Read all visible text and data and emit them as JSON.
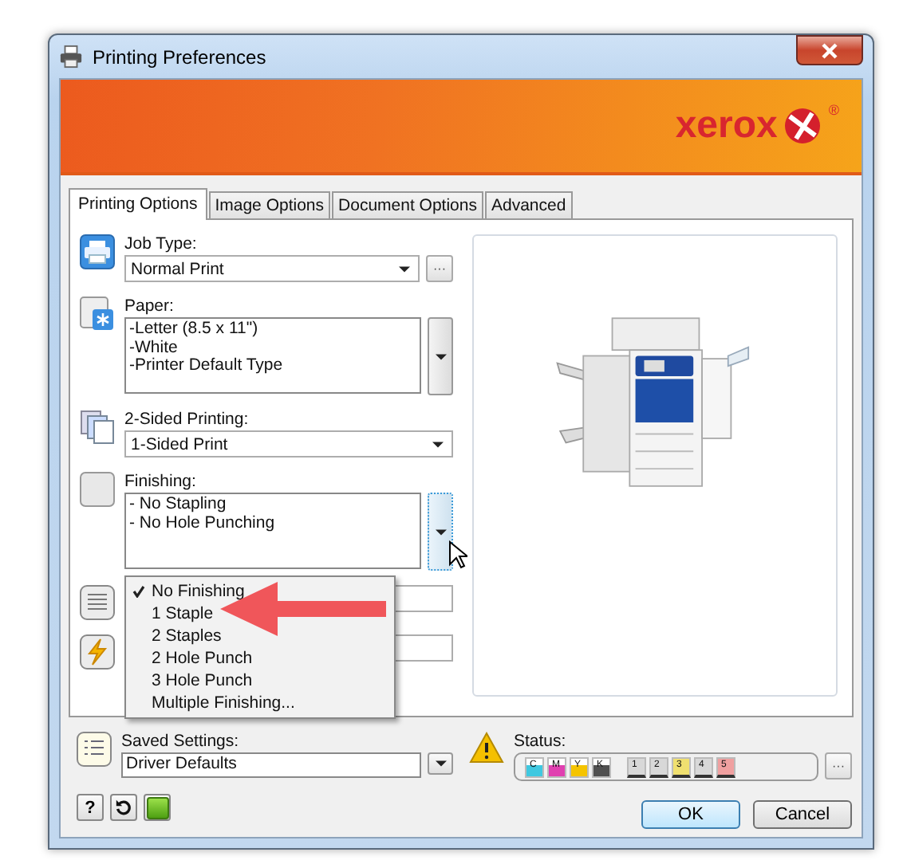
{
  "window": {
    "title": "Printing Preferences"
  },
  "banner": {
    "logo": "xerox",
    "registered": "®"
  },
  "tabs": [
    {
      "label": "Printing Options",
      "selected": true
    },
    {
      "label": "Image Options",
      "selected": false
    },
    {
      "label": "Document Options",
      "selected": false
    },
    {
      "label": "Advanced",
      "selected": false
    }
  ],
  "sections": [
    {
      "kind": "select",
      "label": "Job Type:",
      "value": "Normal Print",
      "more_button": "···"
    },
    {
      "kind": "list",
      "label": "Paper:",
      "lines": [
        "-Letter (8.5 x 11\")",
        "-White",
        "-Printer Default Type"
      ]
    },
    {
      "kind": "select",
      "label": "2-Sided Printing:",
      "value": "1-Sided Print"
    },
    {
      "kind": "list",
      "label": "Finishing:",
      "lines": [
        "- No Stapling",
        "- No Hole Punching"
      ],
      "menu_open": true
    },
    {
      "kind": "select"
    },
    {
      "kind": "select"
    }
  ],
  "finishing_menu": [
    {
      "label": "No Finishing",
      "checked": true
    },
    {
      "label": "1 Staple",
      "checked": false
    },
    {
      "label": "2 Staples",
      "checked": false
    },
    {
      "label": "2 Hole Punch",
      "checked": false
    },
    {
      "label": "3 Hole Punch",
      "checked": false
    },
    {
      "label": "Multiple Finishing...",
      "checked": false
    }
  ],
  "saved_settings": {
    "label": "Saved Settings:",
    "value": "Driver Defaults"
  },
  "status": {
    "label": "Status:",
    "more_button": "···",
    "inks": [
      {
        "label": "C",
        "color": "#3fc8e0"
      },
      {
        "label": "M",
        "color": "#e040b0"
      },
      {
        "label": "Y",
        "color": "#f5c400"
      },
      {
        "label": "K",
        "color": "#505050"
      }
    ],
    "trays": [
      {
        "label": "1",
        "color": "#d8d8d8"
      },
      {
        "label": "2",
        "color": "#d8d8d8"
      },
      {
        "label": "3",
        "color": "#f0e070"
      },
      {
        "label": "4",
        "color": "#d8d8d8"
      },
      {
        "label": "5",
        "color": "#f0a0a0"
      }
    ]
  },
  "footer": {
    "help": "?",
    "buttons": [
      {
        "label": "OK",
        "default": true
      },
      {
        "label": "Cancel",
        "default": false
      }
    ]
  }
}
